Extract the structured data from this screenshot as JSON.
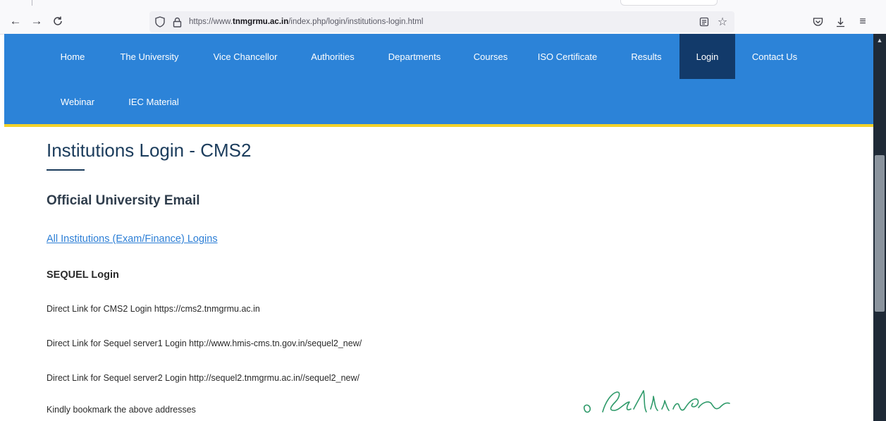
{
  "browser": {
    "url_prefix": "https://www.",
    "url_domain": "tnmgrmu.ac.in",
    "url_path": "/index.php/login/institutions-login.html",
    "icons": {
      "back": "back-arrow-icon",
      "forward": "forward-arrow-icon",
      "reload": "reload-icon",
      "shield": "tracking-shield-icon",
      "lock": "lock-icon",
      "reader": "reader-view-icon",
      "bookmark": "bookmark-star-icon",
      "pocket": "pocket-icon",
      "downloads": "download-icon",
      "menu": "hamburger-menu-icon"
    }
  },
  "navbar": {
    "background": "#2c83d8",
    "active_background": "#123a6a",
    "accent_border": "#f3d22a",
    "items": [
      {
        "label": "Home"
      },
      {
        "label": "The University"
      },
      {
        "label": "Vice Chancellor"
      },
      {
        "label": "Authorities"
      },
      {
        "label": "Departments"
      },
      {
        "label": "Courses"
      },
      {
        "label": "ISO Certificate"
      },
      {
        "label": "Results"
      },
      {
        "label": "Login",
        "active": true
      },
      {
        "label": "Contact Us"
      },
      {
        "label": "Webinar"
      },
      {
        "label": "IEC Material"
      }
    ]
  },
  "content": {
    "title": "Institutions Login - CMS2",
    "subheading": "Official University Email",
    "email_link": "All Institutions (Exam/Finance) Logins",
    "sequel_heading": "SEQUEL Login",
    "lines": [
      "Direct Link for CMS2 Login https://cms2.tnmgrmu.ac.in",
      "Direct Link for Sequel server1 Login http://www.hmis-cms.tn.gov.in/sequel2_new/",
      "Direct Link for Sequel server2 Login http://sequel2.tnmgrmu.ac.in//sequel2_new/",
      "Kindly bookmark the above addresses"
    ],
    "link_color": "#2d7fd6",
    "title_color": "#1b3c5c"
  }
}
